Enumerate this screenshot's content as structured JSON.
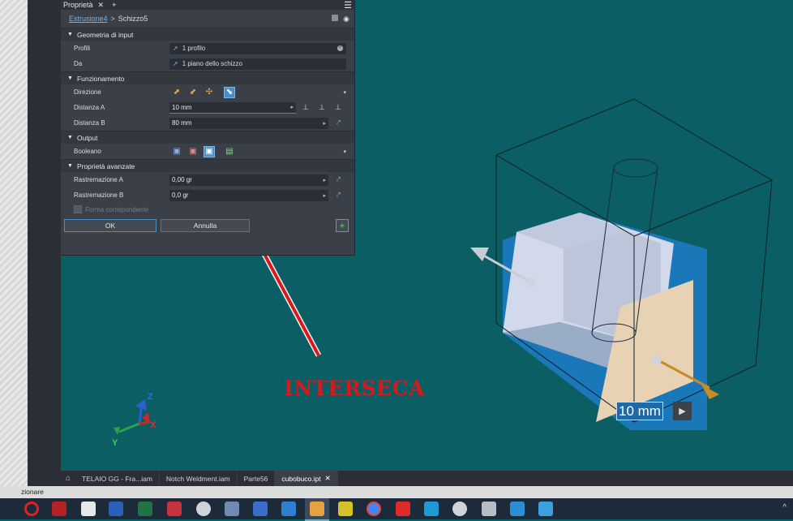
{
  "panel": {
    "title": "Proprietà",
    "close": "✕",
    "add": "+",
    "menu": "☰",
    "breadcrumb": {
      "link": "Estrusione4",
      "sep": ">",
      "current": "Schizzo5"
    },
    "sections": {
      "input": "Geometria di input",
      "behavior": "Funzionamento",
      "output": "Output",
      "advanced": "Proprietà avanzate"
    },
    "rows": {
      "profiles": {
        "label": "Profili",
        "value": "1 profilo"
      },
      "from": {
        "label": "Da",
        "value": "1 piano dello schizzo"
      },
      "direction": {
        "label": "Direzione"
      },
      "distA": {
        "label": "Distanza A",
        "value": "10 mm"
      },
      "distB": {
        "label": "Distanza B",
        "value": "80 mm"
      },
      "boolean": {
        "label": "Booleano"
      },
      "taperA": {
        "label": "Rastremazione A",
        "value": "0,00 gr"
      },
      "taperB": {
        "label": "Rastremazione B",
        "value": "0,0 gr"
      },
      "match": "Forma corrispondente"
    },
    "buttons": {
      "ok": "OK",
      "cancel": "Annulla",
      "add": "+"
    }
  },
  "annotation": {
    "text": "INTERSECA"
  },
  "dimension": {
    "value": "10 mm",
    "arrow": "▶"
  },
  "axes": {
    "x": "X",
    "y": "Y",
    "z": "Z"
  },
  "doctabs": [
    {
      "label": "TELAIO GG - Fra...iam"
    },
    {
      "label": "Notch Weldment.iam"
    },
    {
      "label": "Parte56"
    },
    {
      "label": "cubobuco.ipt",
      "close": "✕"
    }
  ],
  "status": "zionare",
  "colors": {
    "viewport": "#0b5e63",
    "panel": "#3b4048",
    "accent": "#4a90c8",
    "annotation": "#d8191c"
  }
}
